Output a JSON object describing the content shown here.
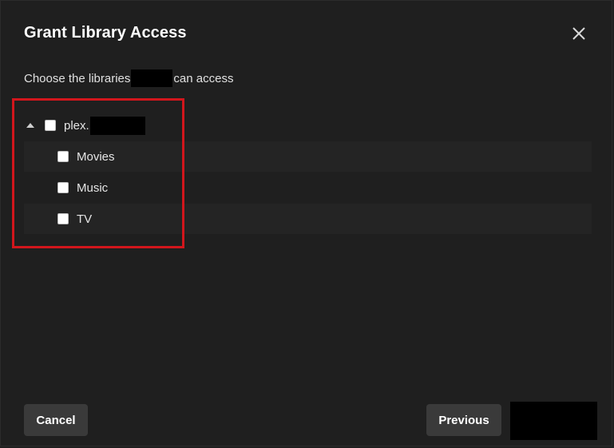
{
  "dialog": {
    "title": "Grant Library Access",
    "close_icon": "close-icon",
    "subtitle_before": "Choose the libraries",
    "subtitle_after": "can access"
  },
  "tree": {
    "server": {
      "label_prefix": "plex.",
      "expanded": true,
      "checked": false,
      "caret_icon": "caret-up-icon"
    },
    "libraries": [
      {
        "label": "Movies",
        "checked": false
      },
      {
        "label": "Music",
        "checked": false
      },
      {
        "label": "TV",
        "checked": false
      }
    ]
  },
  "footer": {
    "cancel_label": "Cancel",
    "previous_label": "Previous"
  },
  "colors": {
    "background": "#1f1f1f",
    "button": "#3a3a3a",
    "highlight_border": "#d2161c",
    "redaction": "#000000"
  }
}
